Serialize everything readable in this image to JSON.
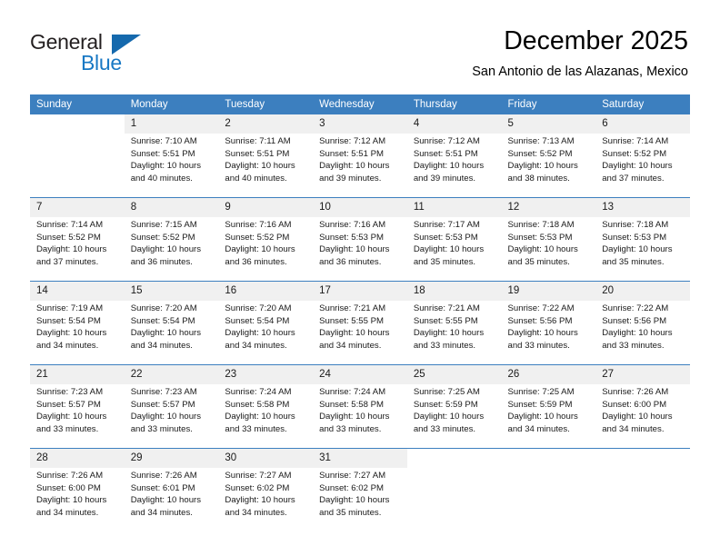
{
  "logo": {
    "word_one": "General",
    "word_two": "Blue",
    "triangle_color": "#1569ad",
    "blue_color": "#1878c4"
  },
  "header": {
    "title": "December 2025",
    "subtitle": "San Antonio de las Alazanas, Mexico"
  },
  "theme": {
    "header_bar_color": "#3c7fbf",
    "daynum_bg": "#f0f0f0",
    "text_color": "#1a1a1a"
  },
  "weekday_headers": [
    "Sunday",
    "Monday",
    "Tuesday",
    "Wednesday",
    "Thursday",
    "Friday",
    "Saturday"
  ],
  "weeks": [
    [
      {
        "day": "",
        "lines": []
      },
      {
        "day": "1",
        "lines": [
          "Sunrise: 7:10 AM",
          "Sunset: 5:51 PM",
          "Daylight: 10 hours",
          "and 40 minutes."
        ]
      },
      {
        "day": "2",
        "lines": [
          "Sunrise: 7:11 AM",
          "Sunset: 5:51 PM",
          "Daylight: 10 hours",
          "and 40 minutes."
        ]
      },
      {
        "day": "3",
        "lines": [
          "Sunrise: 7:12 AM",
          "Sunset: 5:51 PM",
          "Daylight: 10 hours",
          "and 39 minutes."
        ]
      },
      {
        "day": "4",
        "lines": [
          "Sunrise: 7:12 AM",
          "Sunset: 5:51 PM",
          "Daylight: 10 hours",
          "and 39 minutes."
        ]
      },
      {
        "day": "5",
        "lines": [
          "Sunrise: 7:13 AM",
          "Sunset: 5:52 PM",
          "Daylight: 10 hours",
          "and 38 minutes."
        ]
      },
      {
        "day": "6",
        "lines": [
          "Sunrise: 7:14 AM",
          "Sunset: 5:52 PM",
          "Daylight: 10 hours",
          "and 37 minutes."
        ]
      }
    ],
    [
      {
        "day": "7",
        "lines": [
          "Sunrise: 7:14 AM",
          "Sunset: 5:52 PM",
          "Daylight: 10 hours",
          "and 37 minutes."
        ]
      },
      {
        "day": "8",
        "lines": [
          "Sunrise: 7:15 AM",
          "Sunset: 5:52 PM",
          "Daylight: 10 hours",
          "and 36 minutes."
        ]
      },
      {
        "day": "9",
        "lines": [
          "Sunrise: 7:16 AM",
          "Sunset: 5:52 PM",
          "Daylight: 10 hours",
          "and 36 minutes."
        ]
      },
      {
        "day": "10",
        "lines": [
          "Sunrise: 7:16 AM",
          "Sunset: 5:53 PM",
          "Daylight: 10 hours",
          "and 36 minutes."
        ]
      },
      {
        "day": "11",
        "lines": [
          "Sunrise: 7:17 AM",
          "Sunset: 5:53 PM",
          "Daylight: 10 hours",
          "and 35 minutes."
        ]
      },
      {
        "day": "12",
        "lines": [
          "Sunrise: 7:18 AM",
          "Sunset: 5:53 PM",
          "Daylight: 10 hours",
          "and 35 minutes."
        ]
      },
      {
        "day": "13",
        "lines": [
          "Sunrise: 7:18 AM",
          "Sunset: 5:53 PM",
          "Daylight: 10 hours",
          "and 35 minutes."
        ]
      }
    ],
    [
      {
        "day": "14",
        "lines": [
          "Sunrise: 7:19 AM",
          "Sunset: 5:54 PM",
          "Daylight: 10 hours",
          "and 34 minutes."
        ]
      },
      {
        "day": "15",
        "lines": [
          "Sunrise: 7:20 AM",
          "Sunset: 5:54 PM",
          "Daylight: 10 hours",
          "and 34 minutes."
        ]
      },
      {
        "day": "16",
        "lines": [
          "Sunrise: 7:20 AM",
          "Sunset: 5:54 PM",
          "Daylight: 10 hours",
          "and 34 minutes."
        ]
      },
      {
        "day": "17",
        "lines": [
          "Sunrise: 7:21 AM",
          "Sunset: 5:55 PM",
          "Daylight: 10 hours",
          "and 34 minutes."
        ]
      },
      {
        "day": "18",
        "lines": [
          "Sunrise: 7:21 AM",
          "Sunset: 5:55 PM",
          "Daylight: 10 hours",
          "and 33 minutes."
        ]
      },
      {
        "day": "19",
        "lines": [
          "Sunrise: 7:22 AM",
          "Sunset: 5:56 PM",
          "Daylight: 10 hours",
          "and 33 minutes."
        ]
      },
      {
        "day": "20",
        "lines": [
          "Sunrise: 7:22 AM",
          "Sunset: 5:56 PM",
          "Daylight: 10 hours",
          "and 33 minutes."
        ]
      }
    ],
    [
      {
        "day": "21",
        "lines": [
          "Sunrise: 7:23 AM",
          "Sunset: 5:57 PM",
          "Daylight: 10 hours",
          "and 33 minutes."
        ]
      },
      {
        "day": "22",
        "lines": [
          "Sunrise: 7:23 AM",
          "Sunset: 5:57 PM",
          "Daylight: 10 hours",
          "and 33 minutes."
        ]
      },
      {
        "day": "23",
        "lines": [
          "Sunrise: 7:24 AM",
          "Sunset: 5:58 PM",
          "Daylight: 10 hours",
          "and 33 minutes."
        ]
      },
      {
        "day": "24",
        "lines": [
          "Sunrise: 7:24 AM",
          "Sunset: 5:58 PM",
          "Daylight: 10 hours",
          "and 33 minutes."
        ]
      },
      {
        "day": "25",
        "lines": [
          "Sunrise: 7:25 AM",
          "Sunset: 5:59 PM",
          "Daylight: 10 hours",
          "and 33 minutes."
        ]
      },
      {
        "day": "26",
        "lines": [
          "Sunrise: 7:25 AM",
          "Sunset: 5:59 PM",
          "Daylight: 10 hours",
          "and 34 minutes."
        ]
      },
      {
        "day": "27",
        "lines": [
          "Sunrise: 7:26 AM",
          "Sunset: 6:00 PM",
          "Daylight: 10 hours",
          "and 34 minutes."
        ]
      }
    ],
    [
      {
        "day": "28",
        "lines": [
          "Sunrise: 7:26 AM",
          "Sunset: 6:00 PM",
          "Daylight: 10 hours",
          "and 34 minutes."
        ]
      },
      {
        "day": "29",
        "lines": [
          "Sunrise: 7:26 AM",
          "Sunset: 6:01 PM",
          "Daylight: 10 hours",
          "and 34 minutes."
        ]
      },
      {
        "day": "30",
        "lines": [
          "Sunrise: 7:27 AM",
          "Sunset: 6:02 PM",
          "Daylight: 10 hours",
          "and 34 minutes."
        ]
      },
      {
        "day": "31",
        "lines": [
          "Sunrise: 7:27 AM",
          "Sunset: 6:02 PM",
          "Daylight: 10 hours",
          "and 35 minutes."
        ]
      },
      {
        "day": "",
        "lines": []
      },
      {
        "day": "",
        "lines": []
      },
      {
        "day": "",
        "lines": []
      }
    ]
  ]
}
